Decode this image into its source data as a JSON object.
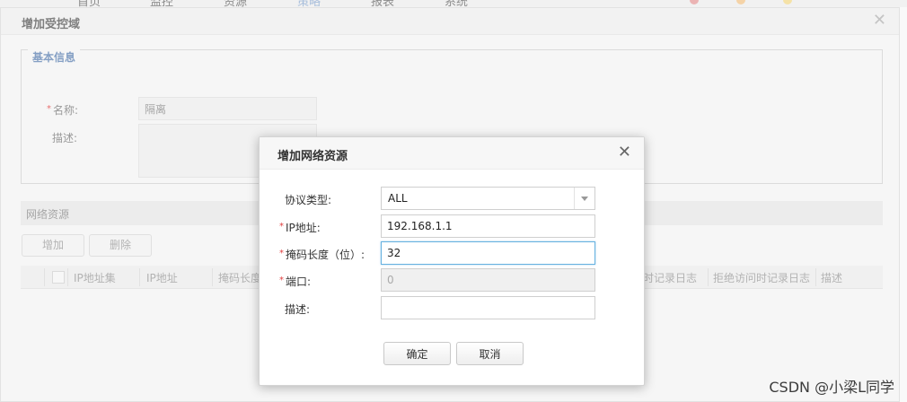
{
  "outer_dialog": {
    "title": "增加受控域",
    "basic_info": {
      "legend": "基本信息",
      "name_label": "名称:",
      "name_value": "隔离",
      "desc_label": "描述:"
    },
    "network": {
      "section_title": "网络资源",
      "add_label": "增加",
      "delete_label": "删除",
      "columns": [
        "IP地址集",
        "IP地址",
        "掩码长度",
        "时记录日志",
        "拒绝访问时记录日志",
        "描述"
      ]
    }
  },
  "modal": {
    "title": "增加网络资源",
    "required_mark": "*",
    "fields": {
      "protocol": {
        "label": "协议类型:",
        "value": "ALL"
      },
      "ip": {
        "label": "IP地址:",
        "value": "192.168.1.1"
      },
      "mask": {
        "label": "掩码长度（位）:",
        "value": "32"
      },
      "port": {
        "label": "端口:",
        "value": "0"
      },
      "desc": {
        "label": "描述:",
        "value": ""
      }
    },
    "ok_label": "确定",
    "cancel_label": "取消"
  },
  "watermark": "CSDN @小梁L同学",
  "icons": {
    "close": "close-icon",
    "dropdown": "chevron-down-icon",
    "checkbox": "checkbox-icon"
  },
  "colors": {
    "required": "#e04040",
    "legend": "#5b7fb0",
    "focus_border": "#66b1e0"
  }
}
